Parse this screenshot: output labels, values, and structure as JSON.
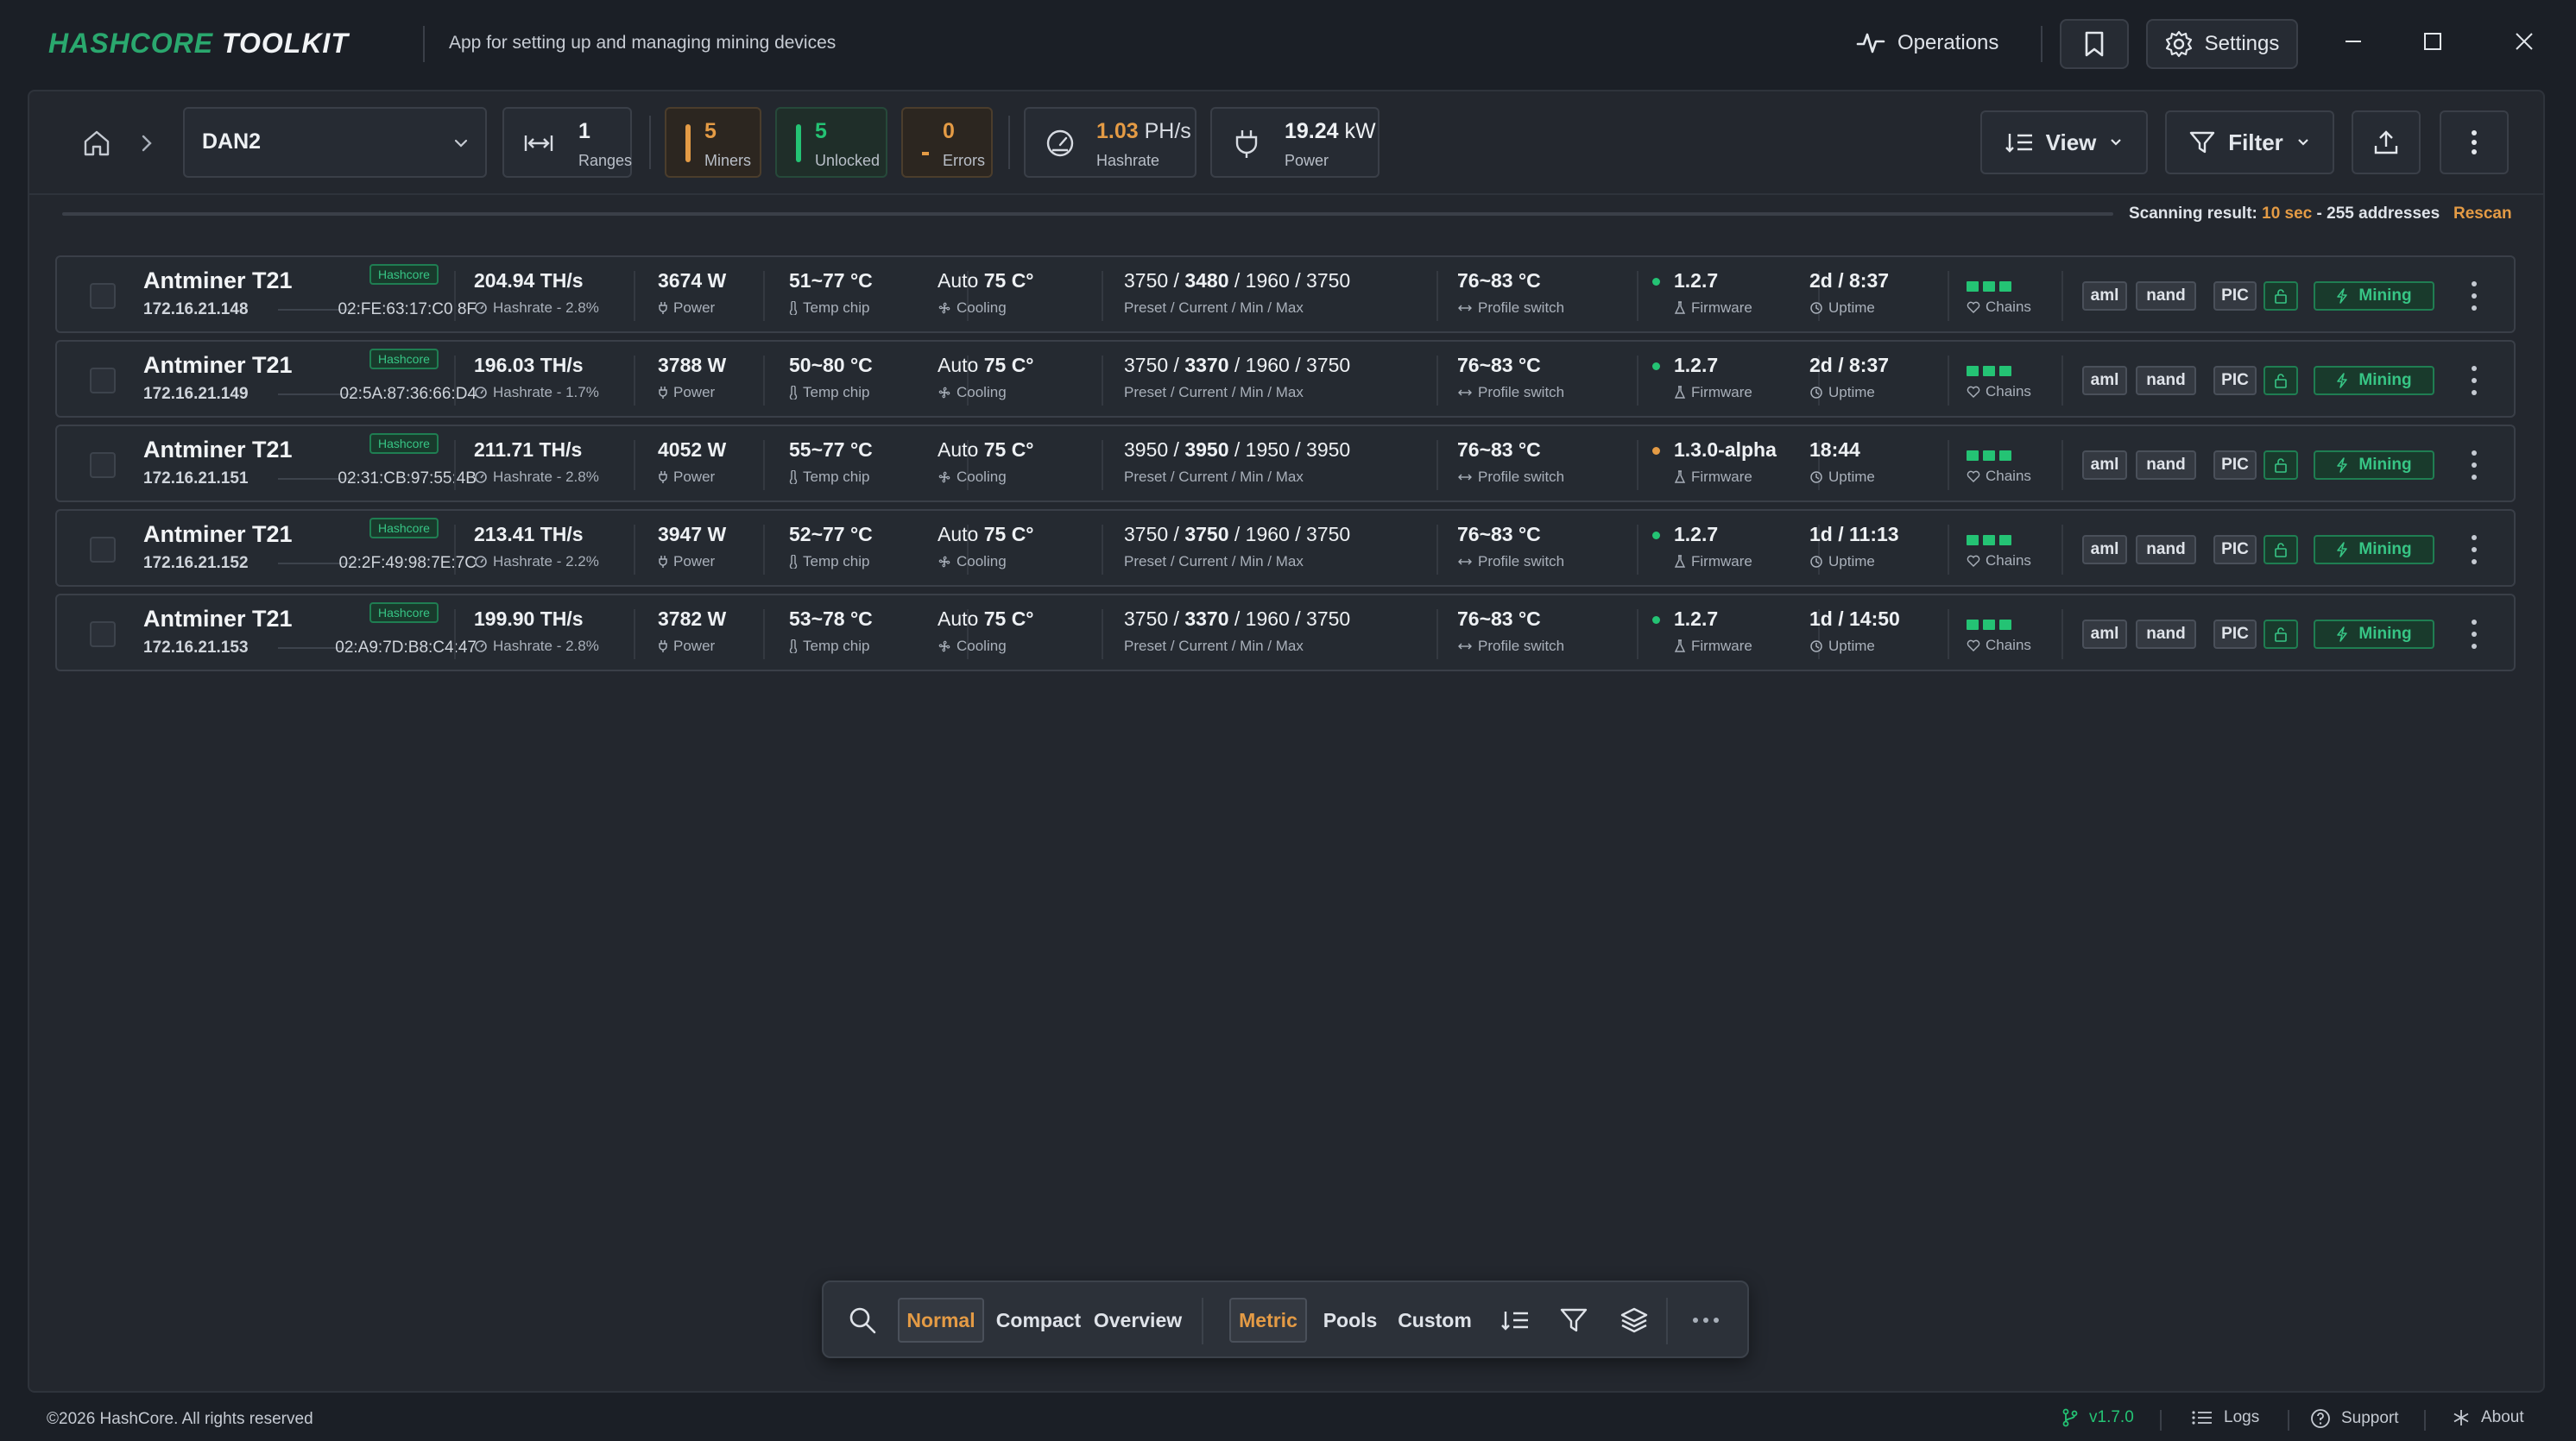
{
  "app": {
    "logo_part1": "HASHCORE",
    "logo_part2": "TOOLKIT",
    "subtitle": "App for setting up and managing mining devices",
    "operations_label": "Operations",
    "settings_label": "Settings"
  },
  "toolbar": {
    "location": "DAN2",
    "ranges_value": "1",
    "ranges_label": "Ranges",
    "miners_value": "5",
    "miners_label": "Miners",
    "unlocked_value": "5",
    "unlocked_label": "Unlocked",
    "errors_value": "0",
    "errors_label": "Errors",
    "hashrate_value": "1.03",
    "hashrate_unit": "PH/s",
    "hashrate_label": "Hashrate",
    "power_value": "19.24",
    "power_unit": "kW",
    "power_label": "Power",
    "view_label": "View",
    "filter_label": "Filter"
  },
  "scan": {
    "prefix": "Scanning result:",
    "time": "10 sec",
    "suffix": "- 255 addresses",
    "rescan_label": "Rescan"
  },
  "rows": [
    {
      "name": "Antminer T21",
      "badge": "Hashcore",
      "ip": "172.16.21.148",
      "mac": "02:FE:63:17:C0:8F",
      "hashrate": "204.94 TH/s",
      "hashrate_sub": "Hashrate - 2.8%",
      "power": "3674 W",
      "power_sub": "Power",
      "temp": "51~77 °C",
      "temp_sub": "Temp chip",
      "cooling_mode": "Auto",
      "cooling_temp": "75 C°",
      "cooling_sub": "Cooling",
      "preset_a": "3750 /",
      "preset_cur": "3480",
      "preset_b": "/ 1960 / 3750",
      "preset_sub": "Preset / Current / Min / Max",
      "profile": "76~83 °C",
      "profile_sub": "Profile switch",
      "firmware": "1.2.7",
      "firmware_sub": "Firmware",
      "firmware_color": "#24c374",
      "uptime": "2d / 8:37",
      "uptime_sub": "Uptime",
      "chains_sub": "Chains",
      "tag_aml": "aml",
      "tag_nand": "nand",
      "tag_pic": "PIC",
      "status": "Mining"
    },
    {
      "name": "Antminer T21",
      "badge": "Hashcore",
      "ip": "172.16.21.149",
      "mac": "02:5A:87:36:66:D4",
      "hashrate": "196.03 TH/s",
      "hashrate_sub": "Hashrate - 1.7%",
      "power": "3788 W",
      "power_sub": "Power",
      "temp": "50~80 °C",
      "temp_sub": "Temp chip",
      "cooling_mode": "Auto",
      "cooling_temp": "75 C°",
      "cooling_sub": "Cooling",
      "preset_a": "3750 /",
      "preset_cur": "3370",
      "preset_b": "/ 1960 / 3750",
      "preset_sub": "Preset / Current / Min / Max",
      "profile": "76~83 °C",
      "profile_sub": "Profile switch",
      "firmware": "1.2.7",
      "firmware_sub": "Firmware",
      "firmware_color": "#24c374",
      "uptime": "2d / 8:37",
      "uptime_sub": "Uptime",
      "chains_sub": "Chains",
      "tag_aml": "aml",
      "tag_nand": "nand",
      "tag_pic": "PIC",
      "status": "Mining"
    },
    {
      "name": "Antminer T21",
      "badge": "Hashcore",
      "ip": "172.16.21.151",
      "mac": "02:31:CB:97:55:4B",
      "hashrate": "211.71 TH/s",
      "hashrate_sub": "Hashrate - 2.8%",
      "power": "4052 W",
      "power_sub": "Power",
      "temp": "55~77 °C",
      "temp_sub": "Temp chip",
      "cooling_mode": "Auto",
      "cooling_temp": "75 C°",
      "cooling_sub": "Cooling",
      "preset_a": "3950 /",
      "preset_cur": "3950",
      "preset_b": "/ 1950 / 3950",
      "preset_sub": "Preset / Current / Min / Max",
      "profile": "76~83 °C",
      "profile_sub": "Profile switch",
      "firmware": "1.3.0-alpha",
      "firmware_sub": "Firmware",
      "firmware_color": "#e49b45",
      "uptime": "18:44",
      "uptime_sub": "Uptime",
      "chains_sub": "Chains",
      "tag_aml": "aml",
      "tag_nand": "nand",
      "tag_pic": "PIC",
      "status": "Mining"
    },
    {
      "name": "Antminer T21",
      "badge": "Hashcore",
      "ip": "172.16.21.152",
      "mac": "02:2F:49:98:7E:7C",
      "hashrate": "213.41 TH/s",
      "hashrate_sub": "Hashrate - 2.2%",
      "power": "3947 W",
      "power_sub": "Power",
      "temp": "52~77 °C",
      "temp_sub": "Temp chip",
      "cooling_mode": "Auto",
      "cooling_temp": "75 C°",
      "cooling_sub": "Cooling",
      "preset_a": "3750 /",
      "preset_cur": "3750",
      "preset_b": "/ 1960 / 3750",
      "preset_sub": "Preset / Current / Min / Max",
      "profile": "76~83 °C",
      "profile_sub": "Profile switch",
      "firmware": "1.2.7",
      "firmware_sub": "Firmware",
      "firmware_color": "#24c374",
      "uptime": "1d / 11:13",
      "uptime_sub": "Uptime",
      "chains_sub": "Chains",
      "tag_aml": "aml",
      "tag_nand": "nand",
      "tag_pic": "PIC",
      "status": "Mining"
    },
    {
      "name": "Antminer T21",
      "badge": "Hashcore",
      "ip": "172.16.21.153",
      "mac": "02:A9:7D:B8:C4:47",
      "hashrate": "199.90 TH/s",
      "hashrate_sub": "Hashrate - 2.8%",
      "power": "3782 W",
      "power_sub": "Power",
      "temp": "53~78 °C",
      "temp_sub": "Temp chip",
      "cooling_mode": "Auto",
      "cooling_temp": "75 C°",
      "cooling_sub": "Cooling",
      "preset_a": "3750 /",
      "preset_cur": "3370",
      "preset_b": "/ 1960 / 3750",
      "preset_sub": "Preset / Current / Min / Max",
      "profile": "76~83 °C",
      "profile_sub": "Profile switch",
      "firmware": "1.2.7",
      "firmware_sub": "Firmware",
      "firmware_color": "#24c374",
      "uptime": "1d / 14:50",
      "uptime_sub": "Uptime",
      "chains_sub": "Chains",
      "tag_aml": "aml",
      "tag_nand": "nand",
      "tag_pic": "PIC",
      "status": "Mining"
    }
  ],
  "bottombar": {
    "normal": "Normal",
    "compact": "Compact",
    "overview": "Overview",
    "metric": "Metric",
    "pools": "Pools",
    "custom": "Custom"
  },
  "statusbar": {
    "copyright": "©2026 HashCore. All rights reserved",
    "version": "v1.7.0",
    "logs": "Logs",
    "support": "Support",
    "about": "About"
  },
  "colors": {
    "accent_orange": "#e49b45",
    "accent_green": "#24c374",
    "background": "#1b1f26",
    "panel": "#23272e"
  }
}
